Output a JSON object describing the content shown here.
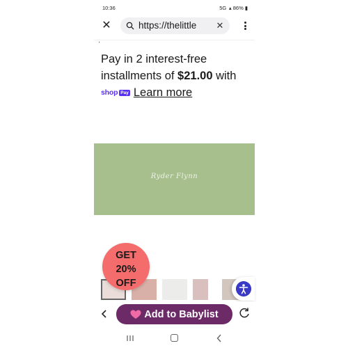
{
  "status_bar": {
    "time": "10:36",
    "indicators": "5G",
    "battery": "86%"
  },
  "browser": {
    "url": "https://thelittle",
    "close_icon": "close-icon",
    "clear_icon": "clear-icon",
    "menu_icon": "kebab-menu-icon"
  },
  "content": {
    "pay_prefix": "Pay in 2 interest-free installments of ",
    "pay_amount": "$21.00",
    "pay_suffix": " with",
    "shop_word": "shop",
    "pay_badge": "Pay",
    "learn_more": "Learn more",
    "banner_name": "Ryder Flynn",
    "banner_color": "#a6bf8d"
  },
  "promo": {
    "line1": "GET",
    "line2": "20%",
    "line3": "OFF",
    "color": "#f46c6c"
  },
  "toolbar": {
    "add_babylist": "Add to Babylist",
    "button_color": "#6c2a67"
  }
}
